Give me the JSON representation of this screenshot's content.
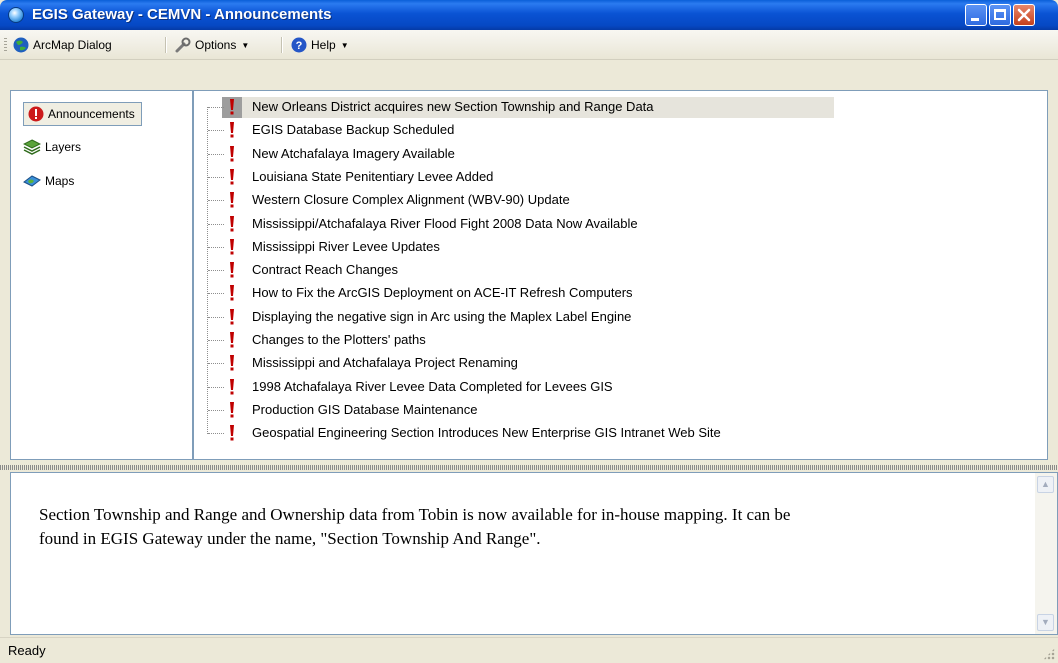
{
  "window": {
    "title": "EGIS Gateway - CEMVN - Announcements"
  },
  "toolbar": {
    "arcmap_label": "ArcMap Dialog",
    "options_label": "Options",
    "help_label": "Help"
  },
  "nav": {
    "items": [
      {
        "label": "Announcements",
        "icon": "alert-icon",
        "selected": true
      },
      {
        "label": "Layers",
        "icon": "layers-icon",
        "selected": false
      },
      {
        "label": "Maps",
        "icon": "maps-icon",
        "selected": false
      }
    ]
  },
  "announcements": [
    "New Orleans District acquires new Section Township and Range Data",
    "EGIS Database Backup Scheduled",
    "New Atchafalaya Imagery Available",
    "Louisiana State Penitentiary Levee Added",
    "Western Closure Complex Alignment (WBV-90) Update",
    "Mississippi/Atchafalaya River Flood Fight 2008 Data Now Available",
    "Mississippi River Levee Updates",
    "Contract Reach Changes",
    "How to Fix the ArcGIS Deployment on ACE-IT Refresh Computers",
    "Displaying the negative sign in Arc using the Maplex Label Engine",
    "Changes to the Plotters' paths",
    "Mississippi and Atchafalaya Project Renaming",
    "1998 Atchafalaya River Levee Data Completed for Levees GIS",
    "Production GIS Database Maintenance",
    "Geospatial Engineering Section Introduces New Enterprise GIS Intranet Web Site"
  ],
  "selected_index": 0,
  "description": {
    "line1": "Section Township and Range and Ownership data from Tobin is now available for in-house mapping. It can be",
    "line2": "found in EGIS Gateway under the name, \"Section Township And Range\"."
  },
  "status": {
    "text": "Ready"
  },
  "colors": {
    "titlebar": "#0a53d4",
    "bang": "#c00000",
    "selection": "#e6e4dc"
  }
}
